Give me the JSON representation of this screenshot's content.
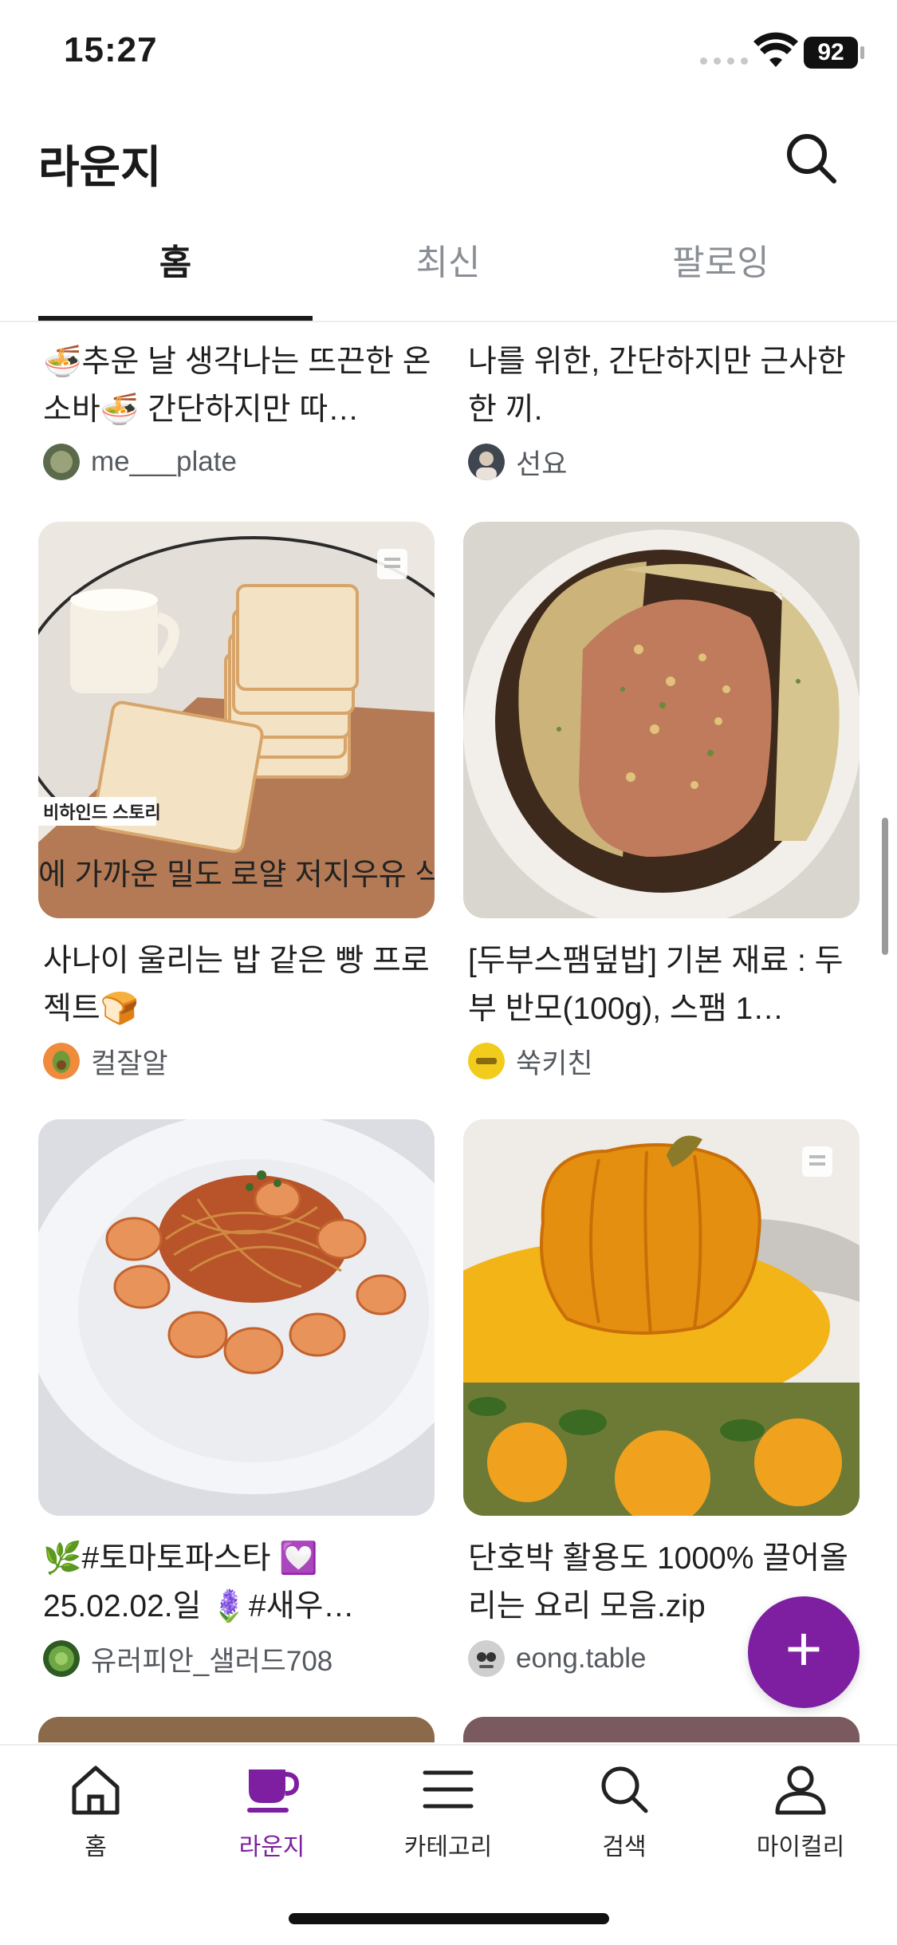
{
  "status_bar": {
    "time": "15:27",
    "battery": "92"
  },
  "header": {
    "title": "라운지",
    "search_icon": "search-icon"
  },
  "tabs": [
    {
      "label": "홈",
      "active": true
    },
    {
      "label": "최신",
      "active": false
    },
    {
      "label": "팔로잉",
      "active": false
    }
  ],
  "feed": {
    "top_row": [
      {
        "caption": "🍜추운 날 생각나는 뜨끈한 온소바🍜  간단하지만 따…",
        "author": "me___plate"
      },
      {
        "caption": "나를 위한, 간단하지만 근사한 한 끼.",
        "author": "선요"
      }
    ],
    "row2": [
      {
        "caption": "사나이 울리는 밥 같은 빵 프로젝트🍞",
        "author": "컬잘알",
        "image_text_1": "비하인드 스토리",
        "image_text_2": "에 가까운 밀도 로얄 저지우유 식빵"
      },
      {
        "caption": "[두부스팸덮밥] 기본 재료 : 두부 반모(100g), 스팸 1…",
        "author": "쑥키친"
      }
    ],
    "row3": [
      {
        "caption": "🌿#토마토파스타 💟 25.02.02.일 🪻#새우…",
        "author": "유러피안_샐러드708"
      },
      {
        "caption": "단호박 활용도 1000% 끌어올리는 요리 모음.zip",
        "author": "eong.table"
      }
    ]
  },
  "fab": {
    "label": "+"
  },
  "bottom_nav": [
    {
      "label": "홈",
      "icon": "home-icon",
      "active": false
    },
    {
      "label": "라운지",
      "icon": "coffee-cup-icon",
      "active": true
    },
    {
      "label": "카테고리",
      "icon": "menu-icon",
      "active": false
    },
    {
      "label": "검색",
      "icon": "search-icon",
      "active": false
    },
    {
      "label": "마이컬리",
      "icon": "user-icon",
      "active": false
    }
  ],
  "colors": {
    "accent": "#7d1fa0",
    "text": "#1a1a1a",
    "muted": "#8a8f96"
  }
}
